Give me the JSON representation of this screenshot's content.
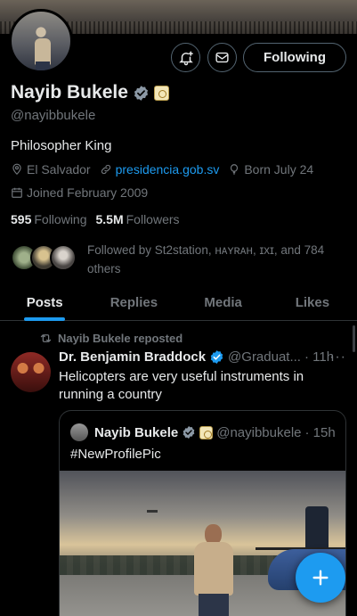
{
  "profile": {
    "name": "Nayib Bukele",
    "handle": "@nayibbukele",
    "bio": "Philosopher King",
    "location": "El Salvador",
    "website": "presidencia.gob.sv",
    "birthday": "Born July 24",
    "joined": "Joined February 2009",
    "following_count": "595",
    "following_label": "Following",
    "followers_count": "5.5M",
    "followers_label": "Followers",
    "followed_by": "Followed by St2station, ʜᴀʏʀᴀʜ, ɪхɪ, and 784 others"
  },
  "actions": {
    "follow_state": "Following",
    "notify_icon": "bell-plus-icon",
    "message_icon": "envelope-icon"
  },
  "tabs": [
    {
      "label": "Posts",
      "active": true
    },
    {
      "label": "Replies",
      "active": false
    },
    {
      "label": "Media",
      "active": false
    },
    {
      "label": "Likes",
      "active": false
    }
  ],
  "tweet": {
    "repost_label": "Nayib Bukele reposted",
    "author_name": "Dr. Benjamin Braddock",
    "author_handle": "@Graduat...",
    "time": "· 11h",
    "more": "···",
    "text": "Helicopters are very useful instruments in running a country",
    "quote": {
      "author_name": "Nayib Bukele",
      "author_handle": "@nayibbukele",
      "time": "· 15h",
      "text": "#NewProfilePic"
    }
  },
  "colors": {
    "accent": "#1d9bf0",
    "background": "#000000",
    "muted_text": "#71767b",
    "primary_text": "#e7e9ea",
    "border": "#2f3336"
  },
  "fab": {
    "icon": "plus-icon"
  }
}
